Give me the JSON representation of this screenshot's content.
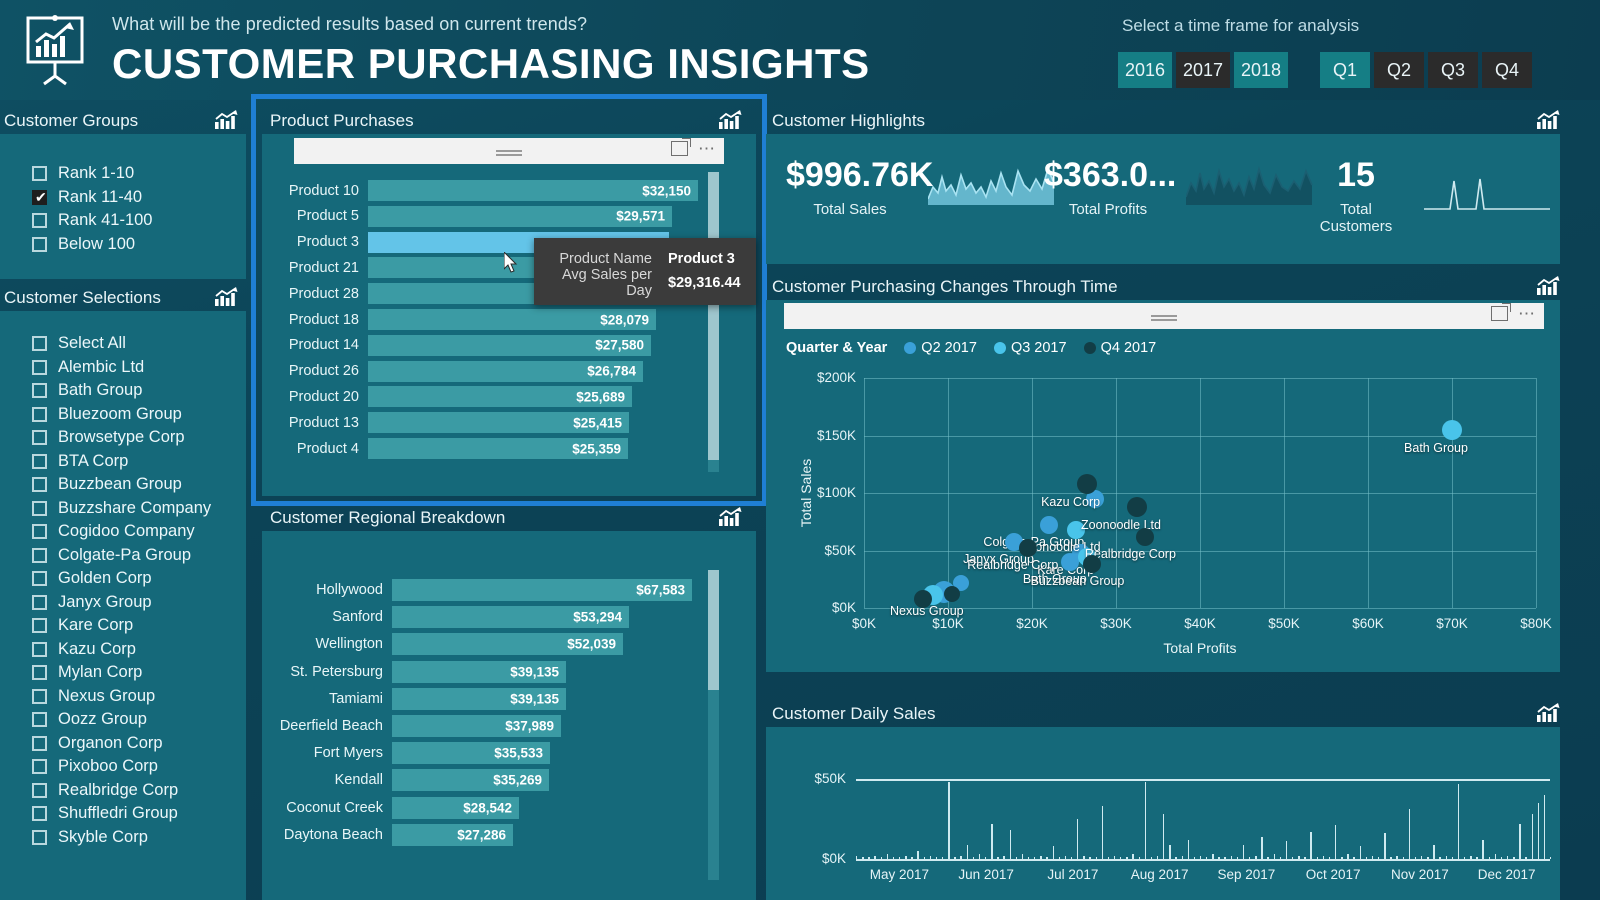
{
  "header": {
    "icon": "presentation-chart-icon",
    "question": "What will be the predicted results based on current trends?",
    "title": "CUSTOMER PURCHASING INSIGHTS",
    "timeframe_label": "Select a time frame for analysis",
    "years": [
      {
        "label": "2016",
        "selected": false
      },
      {
        "label": "2017",
        "selected": true
      },
      {
        "label": "2018",
        "selected": false
      }
    ],
    "quarters": [
      {
        "label": "Q1",
        "selected": false
      },
      {
        "label": "Q2",
        "selected": true
      },
      {
        "label": "Q3",
        "selected": true
      },
      {
        "label": "Q4",
        "selected": true
      }
    ]
  },
  "sidebar": {
    "groups_title": "Customer Groups",
    "groups": [
      {
        "label": "Rank 1-10",
        "checked": false
      },
      {
        "label": "Rank 11-40",
        "checked": true
      },
      {
        "label": "Rank 41-100",
        "checked": false
      },
      {
        "label": "Below 100",
        "checked": false
      }
    ],
    "selections_title": "Customer Selections",
    "selections": [
      {
        "label": "Select All",
        "checked": false
      },
      {
        "label": "Alembic Ltd",
        "checked": false
      },
      {
        "label": "Bath Group",
        "checked": false
      },
      {
        "label": "Bluezoom Group",
        "checked": false
      },
      {
        "label": "Browsetype Corp",
        "checked": false
      },
      {
        "label": "BTA Corp",
        "checked": false
      },
      {
        "label": "Buzzbean Group",
        "checked": false
      },
      {
        "label": "Buzzshare Company",
        "checked": false
      },
      {
        "label": "Cogidoo Company",
        "checked": false
      },
      {
        "label": "Colgate-Pa Group",
        "checked": false
      },
      {
        "label": "Golden Corp",
        "checked": false
      },
      {
        "label": "Janyx Group",
        "checked": false
      },
      {
        "label": "Kare Corp",
        "checked": false
      },
      {
        "label": "Kazu Corp",
        "checked": false
      },
      {
        "label": "Mylan Corp",
        "checked": false
      },
      {
        "label": "Nexus Group",
        "checked": false
      },
      {
        "label": "Oozz Group",
        "checked": false
      },
      {
        "label": "Organon Corp",
        "checked": false
      },
      {
        "label": "Pixoboo Corp",
        "checked": false
      },
      {
        "label": "Realbridge Corp",
        "checked": false
      },
      {
        "label": "Shuffledri Group",
        "checked": false
      },
      {
        "label": "Skyble Corp",
        "checked": false
      }
    ]
  },
  "product_purchases": {
    "title": "Product Purchases",
    "icon": "trend-chart-icon",
    "focus_icon": "focus-mode-icon",
    "more_icon": "more-options-icon",
    "selected": true,
    "tooltip": {
      "name_key": "Product Name",
      "name_value": "Product 3",
      "metric_key": "Avg Sales per Day",
      "metric_value": "$29,316.44"
    }
  },
  "regional": {
    "title": "Customer Regional Breakdown",
    "icon": "trend-chart-icon"
  },
  "highlights": {
    "title": "Customer Highlights",
    "icon": "trend-chart-icon",
    "kpis": [
      {
        "value": "$996.76K",
        "label": "Total Sales",
        "spark": "total-sales-sparkline"
      },
      {
        "value": "$363.0...",
        "label": "Total Profits",
        "spark": "total-profits-sparkline"
      },
      {
        "value": "15",
        "label": "Total Customers",
        "spark": "total-customers-sparkline"
      }
    ]
  },
  "changes": {
    "title": "Customer Purchasing Changes Through Time",
    "icon": "trend-chart-icon",
    "focus_icon": "focus-mode-icon",
    "more_icon": "more-options-icon"
  },
  "daily": {
    "title": "Customer Daily Sales",
    "icon": "trend-chart-icon"
  },
  "chart_data": [
    {
      "type": "bar",
      "id": "product-purchases",
      "title": "Product Purchases",
      "orientation": "horizontal",
      "xlabel": "",
      "ylabel": "",
      "grid": false,
      "highlight": "Product 3",
      "categories": [
        "Product 10",
        "Product 5",
        "Product 3",
        "Product 21",
        "Product 28",
        "Product 18",
        "Product 14",
        "Product 26",
        "Product 20",
        "Product 13",
        "Product 4"
      ],
      "values": [
        32150,
        29571,
        29316.44,
        29100,
        28900,
        28079,
        27580,
        26784,
        25689,
        25415,
        25359
      ],
      "value_labels": [
        "$32,150",
        "$29,571",
        "",
        "",
        "",
        "$28,079",
        "$27,580",
        "$26,784",
        "$25,689",
        "$25,415",
        "$25,359"
      ]
    },
    {
      "type": "bar",
      "id": "customer-regional-breakdown",
      "title": "Customer Regional Breakdown",
      "orientation": "horizontal",
      "xlabel": "",
      "ylabel": "",
      "grid": false,
      "categories": [
        "Hollywood",
        "Sanford",
        "Wellington",
        "St. Petersburg",
        "Tamiami",
        "Deerfield Beach",
        "Fort Myers",
        "Kendall",
        "Coconut Creek",
        "Daytona Beach"
      ],
      "values": [
        67583,
        53294,
        52039,
        39135,
        39135,
        37989,
        35533,
        35269,
        28542,
        27286
      ],
      "value_labels": [
        "$67,583",
        "$53,294",
        "$52,039",
        "$39,135",
        "$39,135",
        "$37,989",
        "$35,533",
        "$35,269",
        "$28,542",
        "$27,286"
      ]
    },
    {
      "type": "scatter",
      "id": "customer-purchasing-changes-through-time",
      "title": "Customer Purchasing Changes Through Time",
      "legend_title": "Quarter & Year",
      "legend_position": "top",
      "xlabel": "Total Profits",
      "ylabel": "Total Sales",
      "xlim": [
        0,
        80000
      ],
      "ylim": [
        0,
        200000
      ],
      "xticks": [
        "$0K",
        "$10K",
        "$20K",
        "$30K",
        "$40K",
        "$50K",
        "$60K",
        "$70K",
        "$80K"
      ],
      "yticks": [
        "$0K",
        "$50K",
        "$100K",
        "$150K",
        "$200K"
      ],
      "grid": true,
      "series": [
        {
          "name": "Q2 2017",
          "color": "#3aa0d8",
          "points": [
            {
              "x": 27500,
              "y": 95000,
              "label": "",
              "r": 9
            },
            {
              "x": 22000,
              "y": 72000,
              "label": "Colgate-Pa Group",
              "r": 9
            },
            {
              "x": 17800,
              "y": 57000,
              "label": "Janyx Group",
              "r": 9
            },
            {
              "x": 25800,
              "y": 48000,
              "label": "Kare Corp",
              "r": 9
            },
            {
              "x": 24500,
              "y": 40000,
              "label": "Bath Group",
              "r": 9
            },
            {
              "x": 9500,
              "y": 14000,
              "label": "Nexus Group",
              "r": 11
            },
            {
              "x": 11500,
              "y": 22000,
              "label": "",
              "r": 8
            }
          ]
        },
        {
          "name": "Q3 2017",
          "color": "#49c4ea",
          "points": [
            {
              "x": 70000,
              "y": 155000,
              "label": "Bath Group",
              "r": 10
            },
            {
              "x": 25200,
              "y": 68000,
              "label": "Zoonoodle Ltd",
              "r": 9
            },
            {
              "x": 26500,
              "y": 44000,
              "label": "",
              "r": 9
            },
            {
              "x": 8200,
              "y": 11000,
              "label": "",
              "r": 10
            }
          ]
        },
        {
          "name": "Q4 2017",
          "color": "#123d45",
          "points": [
            {
              "x": 26500,
              "y": 108000,
              "label": "Kazu Corp",
              "r": 10
            },
            {
              "x": 32500,
              "y": 88000,
              "label": "Zoonoodle Ltd",
              "r": 10
            },
            {
              "x": 33500,
              "y": 62000,
              "label": "Realbridge Corp",
              "r": 9
            },
            {
              "x": 19500,
              "y": 52000,
              "label": "Realbridge Corp",
              "r": 9
            },
            {
              "x": 27200,
              "y": 38000,
              "label": "Buzzbean Group",
              "r": 9
            },
            {
              "x": 7000,
              "y": 8000,
              "label": "",
              "r": 9
            },
            {
              "x": 10500,
              "y": 12000,
              "label": "",
              "r": 8
            }
          ]
        }
      ]
    },
    {
      "type": "line",
      "id": "customer-daily-sales",
      "title": "Customer Daily Sales",
      "xlabel": "",
      "ylabel": "",
      "ylim": [
        0,
        50000
      ],
      "yticks": [
        "$0K",
        "$50K"
      ],
      "xticks": [
        "May 2017",
        "Jun 2017",
        "Jul 2017",
        "Aug 2017",
        "Sep 2017",
        "Oct 2017",
        "Nov 2017",
        "Dec 2017"
      ],
      "grid": false,
      "series": [
        {
          "name": "Daily Sales",
          "color": "#bfe6ea",
          "values": [
            2,
            1,
            1,
            2,
            1,
            3,
            1,
            1,
            2,
            1,
            5,
            1,
            2,
            1,
            1,
            48,
            1,
            2,
            9,
            1,
            3,
            1,
            22,
            1,
            2,
            18,
            1,
            3,
            1,
            1,
            2,
            1,
            8,
            1,
            2,
            1,
            25,
            2,
            1,
            1,
            33,
            1,
            2,
            1,
            1,
            3,
            1,
            48,
            1,
            2,
            28,
            9,
            1,
            2,
            12,
            1,
            2,
            1,
            3,
            1,
            1,
            2,
            1,
            9,
            1,
            2,
            14,
            1,
            3,
            1,
            11,
            1,
            2,
            1,
            17,
            1,
            2,
            1,
            21,
            1,
            3,
            1,
            8,
            1,
            2,
            1,
            16,
            1,
            2,
            1,
            31,
            1,
            2,
            1,
            9,
            1,
            2,
            1,
            47,
            1,
            2,
            1,
            12,
            1,
            3,
            1,
            2,
            1,
            22,
            1,
            28,
            35,
            40,
            1
          ]
        }
      ]
    }
  ]
}
